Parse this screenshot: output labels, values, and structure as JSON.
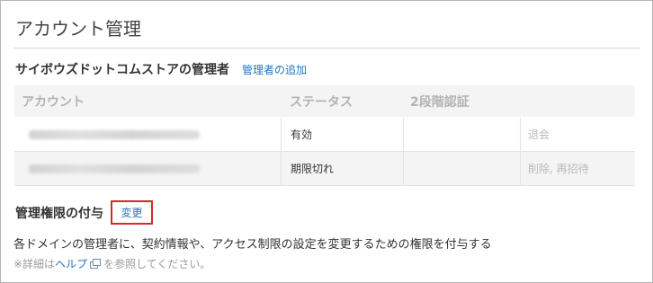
{
  "page": {
    "title": "アカウント管理"
  },
  "admins_section": {
    "title": "サイボウズドットコムストアの管理者",
    "add_link": "管理者の追加"
  },
  "table": {
    "headers": [
      "アカウント",
      "ステータス",
      "2段階認証",
      ""
    ],
    "rows": [
      {
        "account": "",
        "status": "有効",
        "two_factor": "",
        "actions": [
          "退会"
        ]
      },
      {
        "account": "",
        "status": "期限切れ",
        "two_factor": "",
        "actions": [
          "削除",
          "再招待"
        ]
      }
    ]
  },
  "grant_section": {
    "title": "管理権限の付与",
    "change_link": "変更",
    "description": "各ドメインの管理者に、契約情報や、アクセス制限の設定を変更するための権限を付与する",
    "note_prefix": "※詳細は",
    "note_link": "ヘルプ",
    "note_suffix": "を参照してください。"
  },
  "colors": {
    "link": "#1f75c6",
    "highlight": "#d32a2a"
  },
  "icons": {
    "external": "external-link-icon"
  }
}
